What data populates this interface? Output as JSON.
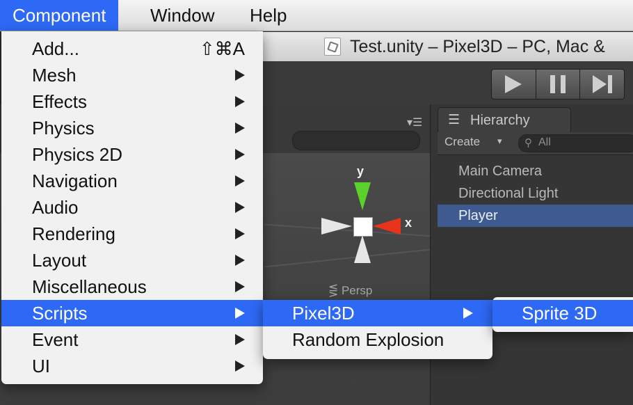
{
  "menubar": {
    "items": [
      {
        "label": "Component",
        "active": true
      },
      {
        "label": "Window",
        "active": false
      },
      {
        "label": "Help",
        "active": false
      }
    ]
  },
  "window": {
    "title": "Test.unity – Pixel3D – PC, Mac &"
  },
  "toolbar": {
    "play_icon": "play-icon",
    "pause_icon": "pause-icon",
    "step_icon": "step-icon"
  },
  "scene": {
    "gizmo": {
      "y_label": "y",
      "x_label": "x"
    },
    "persp_label": "⋚ Persp",
    "menu_glyph": "▾☰"
  },
  "hierarchy": {
    "tab_icon_glyph": "☰",
    "tab_label": "Hierarchy",
    "create_label": "Create",
    "create_arrow": "▾",
    "search_icon_glyph": "⚲",
    "search_placeholder": "All",
    "items": [
      {
        "label": "Main Camera",
        "selected": false
      },
      {
        "label": "Directional Light",
        "selected": false
      },
      {
        "label": "Player",
        "selected": true
      }
    ]
  },
  "component_menu": {
    "items": [
      {
        "label": "Add...",
        "shortcut": "⇧⌘A",
        "submenu": false,
        "highlighted": false
      },
      {
        "label": "Mesh",
        "shortcut": "",
        "submenu": true,
        "highlighted": false
      },
      {
        "label": "Effects",
        "shortcut": "",
        "submenu": true,
        "highlighted": false
      },
      {
        "label": "Physics",
        "shortcut": "",
        "submenu": true,
        "highlighted": false
      },
      {
        "label": "Physics 2D",
        "shortcut": "",
        "submenu": true,
        "highlighted": false
      },
      {
        "label": "Navigation",
        "shortcut": "",
        "submenu": true,
        "highlighted": false
      },
      {
        "label": "Audio",
        "shortcut": "",
        "submenu": true,
        "highlighted": false
      },
      {
        "label": "Rendering",
        "shortcut": "",
        "submenu": true,
        "highlighted": false
      },
      {
        "label": "Layout",
        "shortcut": "",
        "submenu": true,
        "highlighted": false
      },
      {
        "label": "Miscellaneous",
        "shortcut": "",
        "submenu": true,
        "highlighted": false
      },
      {
        "label": "Scripts",
        "shortcut": "",
        "submenu": true,
        "highlighted": true
      },
      {
        "label": "Event",
        "shortcut": "",
        "submenu": true,
        "highlighted": false
      },
      {
        "label": "UI",
        "shortcut": "",
        "submenu": true,
        "highlighted": false
      }
    ]
  },
  "scripts_menu": {
    "items": [
      {
        "label": "Pixel3D",
        "submenu": true,
        "highlighted": true
      },
      {
        "label": "Random Explosion",
        "submenu": false,
        "highlighted": false
      }
    ]
  },
  "pixel3d_menu": {
    "items": [
      {
        "label": "Sprite 3D",
        "submenu": false,
        "highlighted": true
      }
    ]
  },
  "colors": {
    "menu_highlight": "#2e69f5",
    "menu_background": "#f1f1f1",
    "hierarchy_selected": "#3f5a8e",
    "gizmo_y": "#5bd22b",
    "gizmo_x": "#e8341b"
  }
}
